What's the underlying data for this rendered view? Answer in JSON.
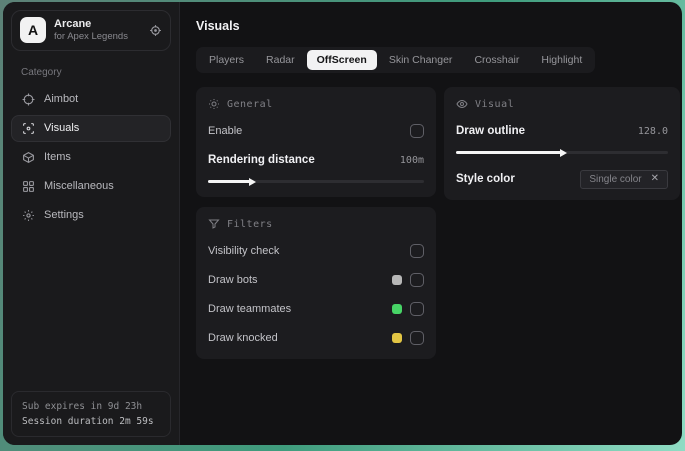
{
  "sidebar": {
    "logo_letter": "A",
    "app_name": "Arcane",
    "app_subtitle": "for Apex Legends",
    "category_label": "Category",
    "items": [
      {
        "label": "Aimbot"
      },
      {
        "label": "Visuals"
      },
      {
        "label": "Items"
      },
      {
        "label": "Miscellaneous"
      },
      {
        "label": "Settings"
      }
    ],
    "footer": {
      "line1": "Sub expires in 9d 23h",
      "line2": "Session duration 2m 59s"
    }
  },
  "header": {
    "title": "Visuals"
  },
  "tabs": [
    {
      "label": "Players"
    },
    {
      "label": "Radar"
    },
    {
      "label": "OffScreen",
      "selected": true
    },
    {
      "label": "Skin Changer"
    },
    {
      "label": "Crosshair"
    },
    {
      "label": "Highlight"
    }
  ],
  "general": {
    "section_label": "General",
    "enable_label": "Enable",
    "rendering_distance_label": "Rendering distance",
    "rendering_distance_value": "100m",
    "rendering_distance_percent": "20"
  },
  "visual": {
    "section_label": "Visual",
    "draw_outline_label": "Draw outline",
    "draw_outline_value": "128.0",
    "draw_outline_percent": "50",
    "style_color_label": "Style color",
    "style_color_value": "Single color",
    "clear_glyph": "✕"
  },
  "filters": {
    "section_label": "Filters",
    "rows": [
      {
        "label": "Visibility check",
        "swatch": null
      },
      {
        "label": "Draw bots",
        "swatch": "#b7b7b7"
      },
      {
        "label": "Draw teammates",
        "swatch": "#47d466"
      },
      {
        "label": "Draw knocked",
        "swatch": "#e2c544"
      }
    ]
  },
  "colors": {
    "accent_mint": "#8fdcc4",
    "window_bg": "#121214",
    "card_bg": "#1c1c1f",
    "selected_pill": "#f2f2f3"
  }
}
